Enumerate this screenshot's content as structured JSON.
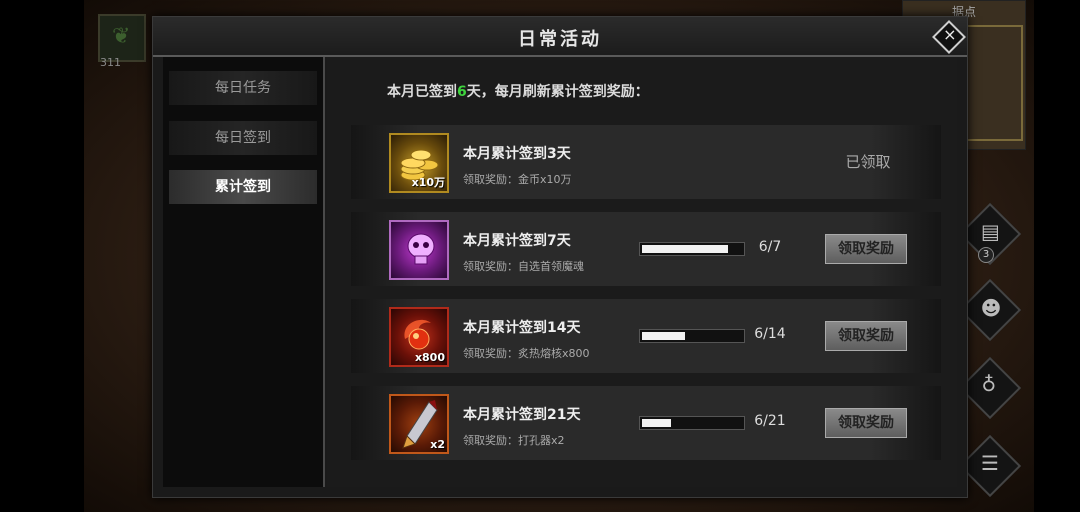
{
  "background": {
    "count": "311",
    "minimap_title": "据点",
    "side_badge": "3"
  },
  "dialog": {
    "title": "日常活动",
    "tabs": [
      {
        "label": "每日任务",
        "active": false
      },
      {
        "label": "每日签到",
        "active": false
      },
      {
        "label": "累计签到",
        "active": true
      }
    ],
    "summary": {
      "prefix": "本月已签到",
      "days": "6",
      "suffix": "天，每月刷新累计签到奖励："
    },
    "rewards": [
      {
        "title": "本月累计签到3天",
        "reward": "领取奖励：金币x10万",
        "qty": "x10万",
        "icon": "gold-coins",
        "status": "已领取",
        "claimed": true
      },
      {
        "title": "本月累计签到7天",
        "reward": "领取奖励：自选首领魔魂",
        "qty": "",
        "icon": "purple-skull",
        "progress_text": "6/7",
        "progress": 0.857,
        "button": "领取奖励",
        "claimed": false
      },
      {
        "title": "本月累计签到14天",
        "reward": "领取奖励：炙热熔核x800",
        "qty": "x800",
        "icon": "molten-core",
        "progress_text": "6/14",
        "progress": 0.4286,
        "button": "领取奖励",
        "claimed": false
      },
      {
        "title": "本月累计签到21天",
        "reward": "领取奖励：打孔器x2",
        "qty": "x2",
        "icon": "drill-blade",
        "progress_text": "6/21",
        "progress": 0.2857,
        "button": "领取奖励",
        "claimed": false
      }
    ]
  },
  "colors": {
    "highlight": "#3ed43e",
    "gold_border": "#b08a20",
    "purple_border": "#b06ac0",
    "red_border": "#b02a1a",
    "orange_border": "#c0581a"
  }
}
